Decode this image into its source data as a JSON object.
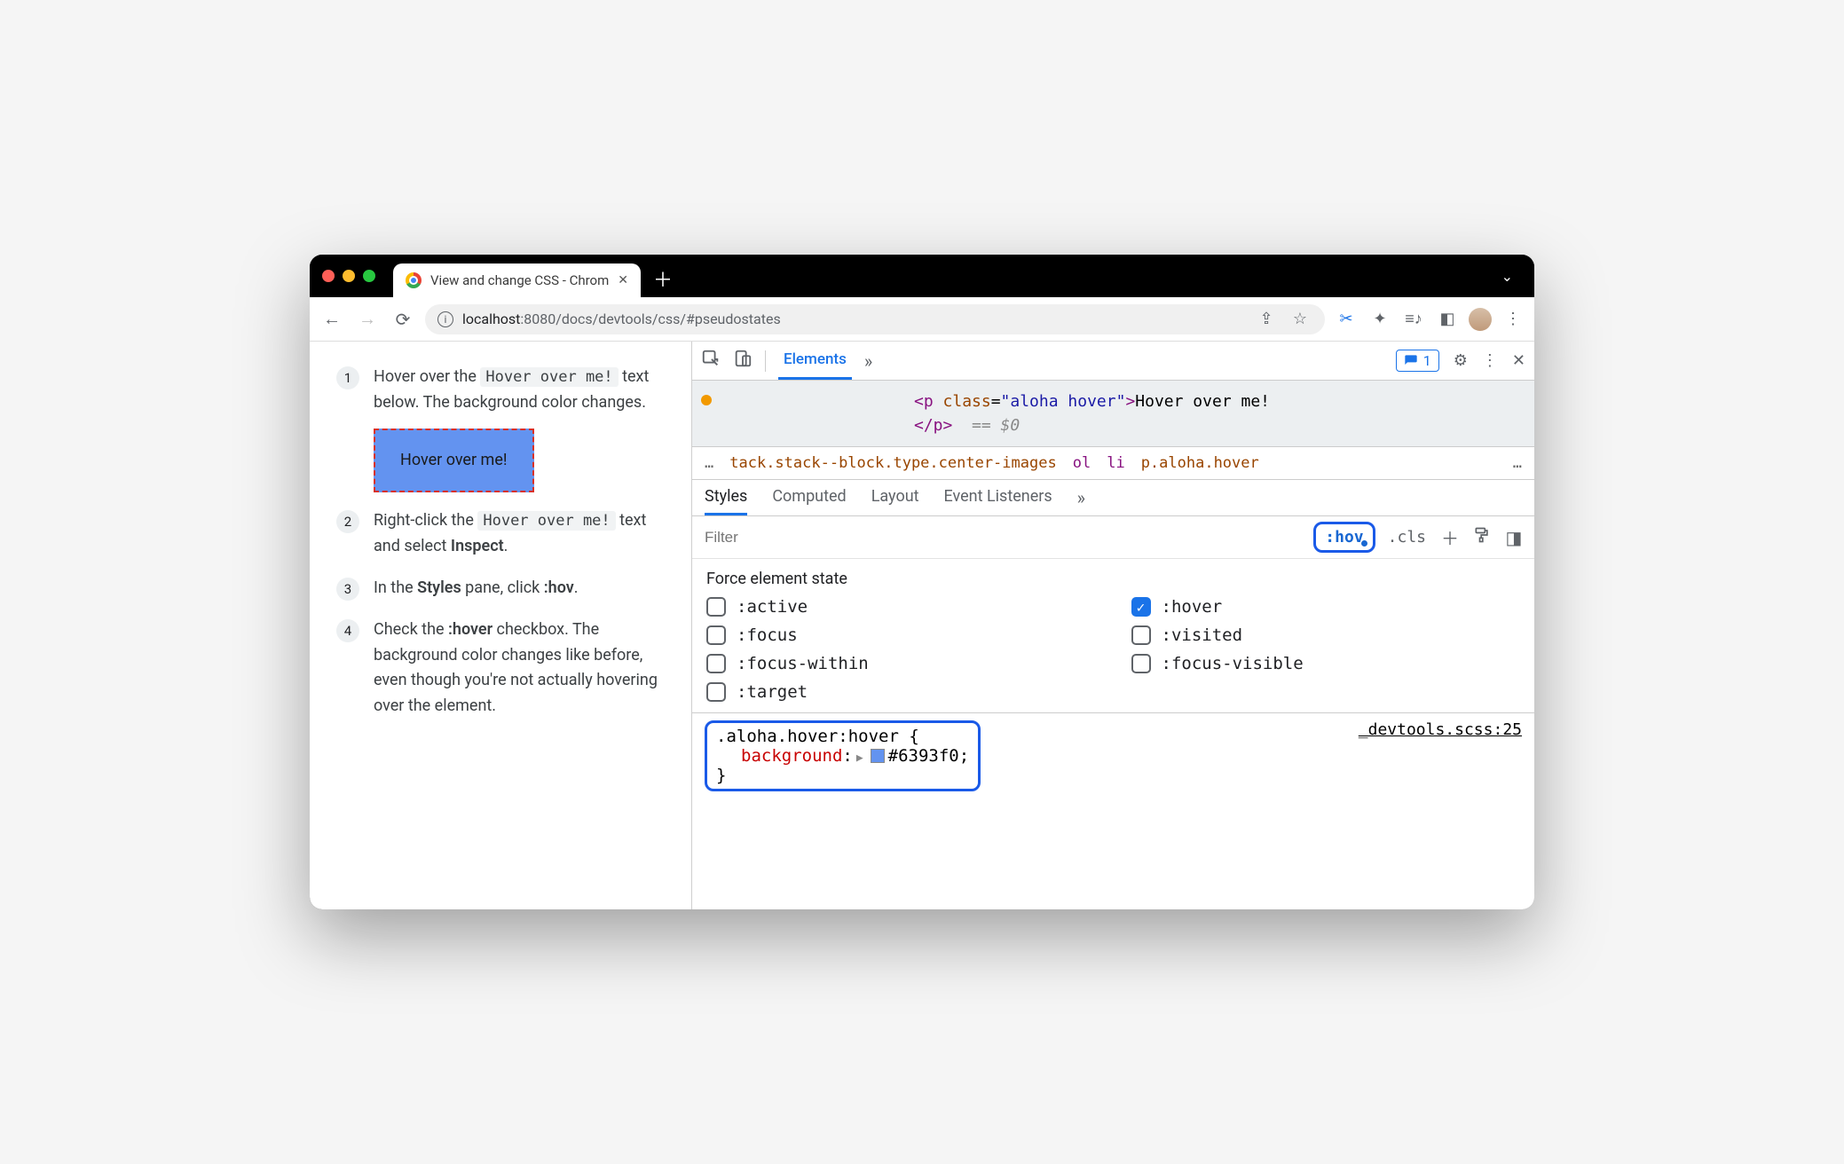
{
  "tab": {
    "title": "View and change CSS - Chrom"
  },
  "address": {
    "host": "localhost",
    "port": ":8080",
    "path": "/docs/devtools/css/#pseudostates"
  },
  "steps": {
    "s1": {
      "num": "1",
      "pre": "Hover over the ",
      "code": "Hover over me!",
      "post": " text below. The background color changes."
    },
    "demo": "Hover over me!",
    "s2": {
      "num": "2",
      "pre": "Right-click the ",
      "code": "Hover over me!",
      "post1": " text and select ",
      "bold": "Inspect",
      "post2": "."
    },
    "s3": {
      "num": "3",
      "pre": "In the ",
      "bold": "Styles",
      "post1": " pane, click ",
      "bold2": ":hov",
      "post2": "."
    },
    "s4": {
      "num": "4",
      "pre": "Check the ",
      "bold": ":hover",
      "post": " checkbox. The background color changes like before, even though you're not actually hovering over the element."
    }
  },
  "devtools": {
    "topTabs": {
      "elements": "Elements"
    },
    "issues": "1",
    "dom": {
      "open": "<p ",
      "classAttr": "class",
      "eq": "=",
      "classVal": "\"aloha hover\"",
      "gt": ">",
      "text": "Hover over me!",
      "close": "</p>",
      "eq0": "== $0"
    },
    "crumbs": {
      "long": "tack.stack--block.type.center-images",
      "ol": "ol",
      "li": "li",
      "sel": "p.aloha.hover"
    },
    "stylesTabs": {
      "styles": "Styles",
      "computed": "Computed",
      "layout": "Layout",
      "listeners": "Event Listeners"
    },
    "filter": {
      "placeholder": "Filter",
      "hov": ":hov",
      "cls": ".cls"
    },
    "force": {
      "title": "Force element state",
      "active": ":active",
      "hover": ":hover",
      "focus": ":focus",
      "visited": ":visited",
      "focusWithin": ":focus-within",
      "focusVisible": ":focus-visible",
      "target": ":target"
    },
    "rule": {
      "selector": ".aloha.hover:hover {",
      "prop": "background",
      "colon": ":",
      "value": "#6393f0",
      "semi": ";",
      "close": "}",
      "source": "_devtools.scss:25"
    }
  }
}
